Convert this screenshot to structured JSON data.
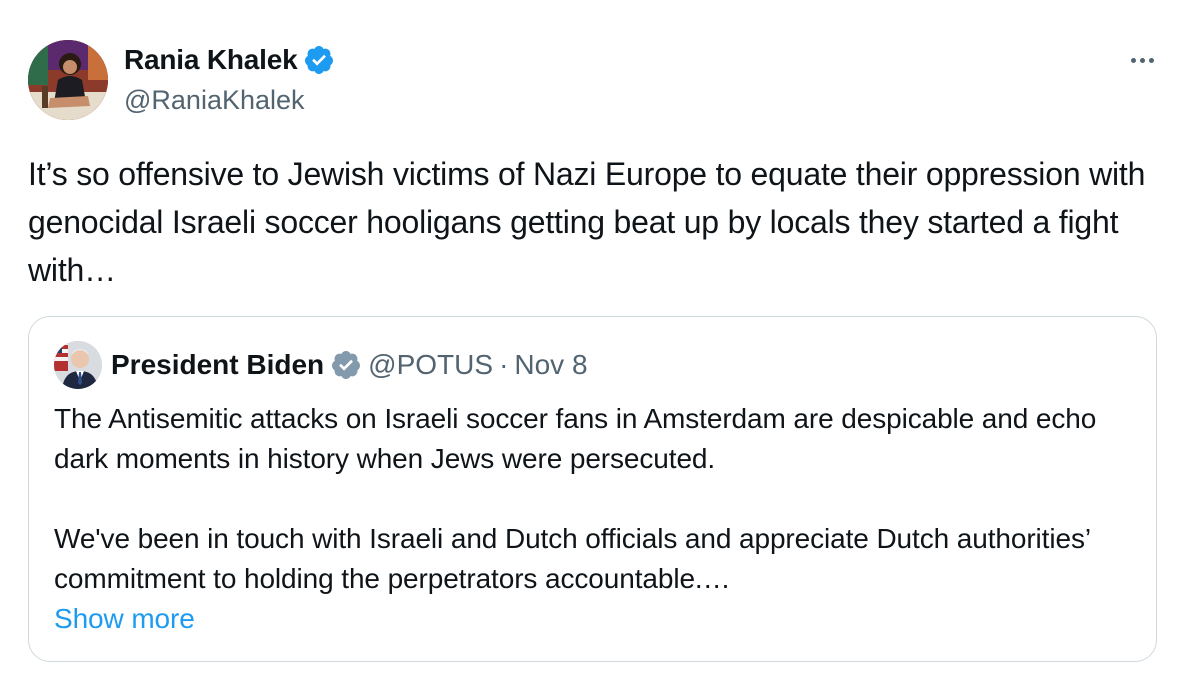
{
  "author": {
    "name": "Rania Khalek",
    "handle": "@RaniaKhalek"
  },
  "tweet": {
    "text": "It’s so offensive to Jewish victims of Nazi Europe to equate their oppression with genocidal Israeli soccer hooligans getting beat up by locals they started a fight with…"
  },
  "quoted": {
    "name": "President Biden",
    "handle": "@POTUS",
    "separator": "·",
    "date": "Nov 8",
    "paragraph1": "The Antisemitic attacks on Israeli soccer fans in Amsterdam are despicable and echo dark moments in history when Jews were persecuted.",
    "paragraph2": "We've been in touch with Israeli and Dutch officials and appreciate Dutch authorities’ commitment to holding the perpetrators accountable.…",
    "show_more": "Show more"
  },
  "icons": {
    "more": "more-horizontal-icon",
    "verified_blue": "verified-badge-icon",
    "verified_gray": "government-badge-icon"
  },
  "colors": {
    "text": "#0f1419",
    "secondary": "#536471",
    "link": "#1d9bf0",
    "verified": "#1d9bf0",
    "government_badge": "#829aab",
    "border": "#cfd9de"
  }
}
